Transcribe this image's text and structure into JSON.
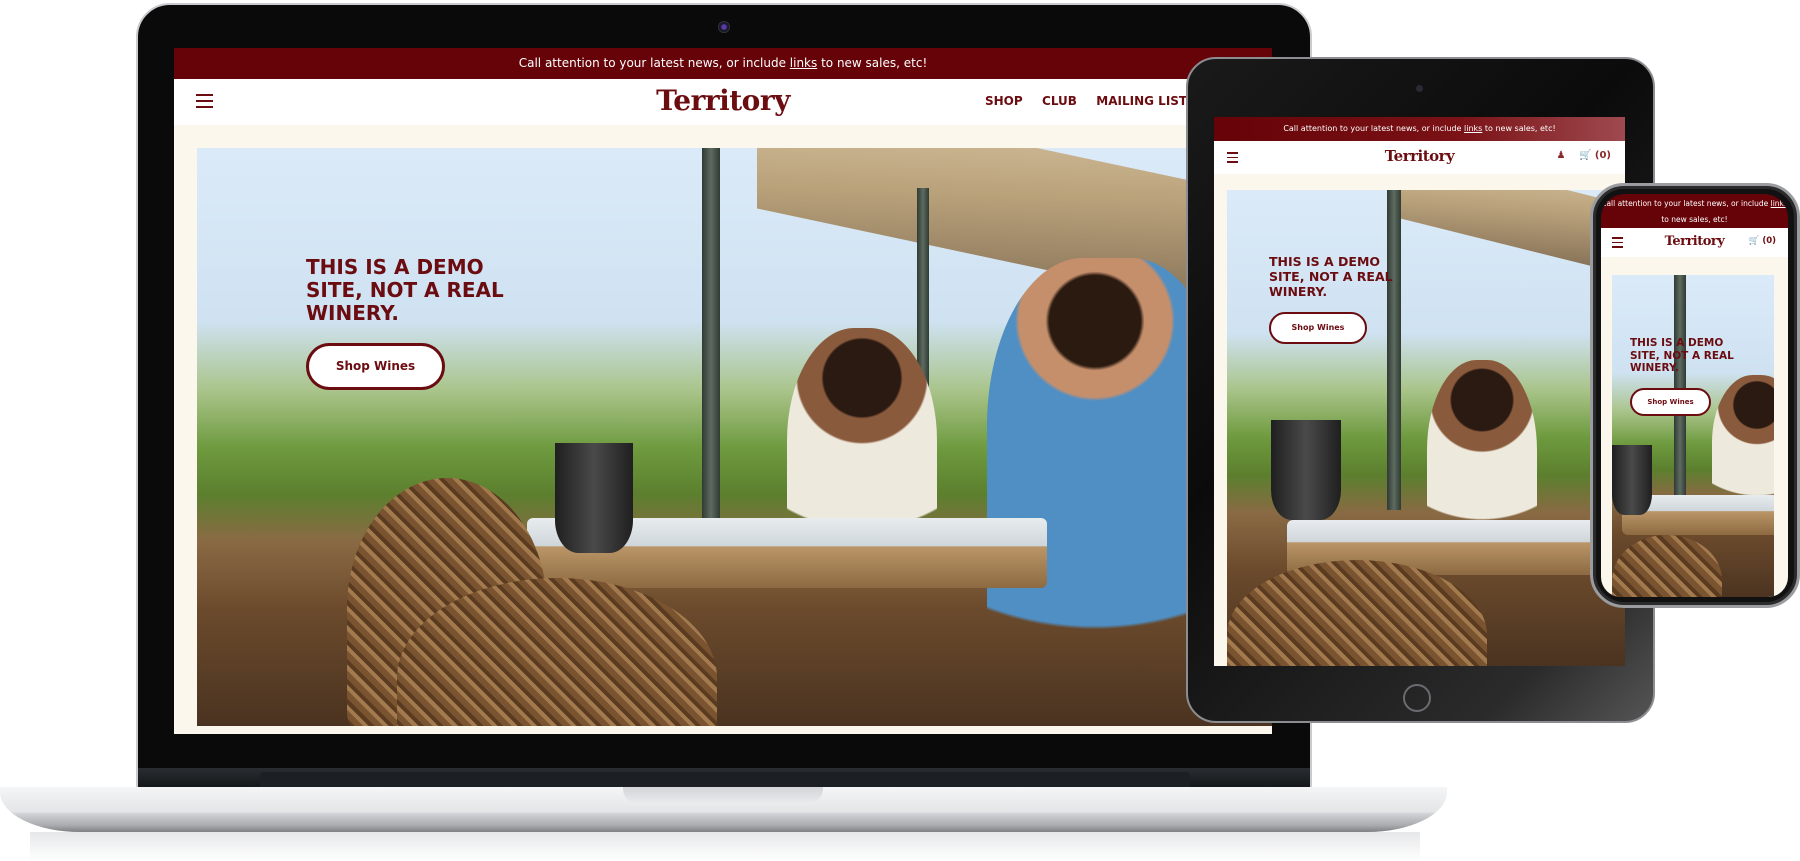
{
  "site": {
    "brand": "Territory",
    "colors": {
      "primary": "#660308",
      "cream": "#fcf7ec",
      "text_accent": "#6b0c10"
    },
    "announcement": {
      "prefix": "Call attention to your latest news, or include ",
      "link": "links",
      "suffix": " to new sales, etc!"
    },
    "nav": [
      "SHOP",
      "CLUB",
      "MAILING LIST"
    ],
    "icons": {
      "menu": "hamburger-icon",
      "account": "user-icon",
      "cart": "cart-icon"
    },
    "cart_count": "(0)",
    "hero": {
      "title_lines": [
        "THIS IS A DEMO",
        "SITE, NOT A REAL",
        "WINERY."
      ],
      "cta": "Shop Wines"
    }
  },
  "devices": [
    "laptop",
    "tablet",
    "phone"
  ]
}
